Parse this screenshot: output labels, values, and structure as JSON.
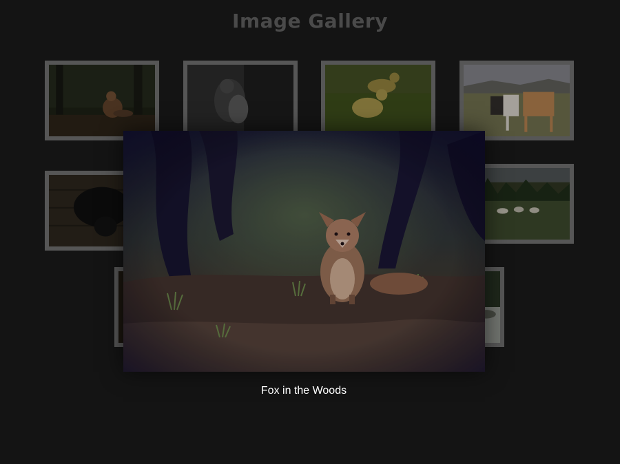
{
  "gallery": {
    "title": "Image Gallery",
    "thumbnails": [
      {
        "subject": "fox"
      },
      {
        "subject": "bw-animal"
      },
      {
        "subject": "ducklings"
      },
      {
        "subject": "horses"
      },
      {
        "subject": "black-dog"
      },
      {
        "subject": "hidden"
      },
      {
        "subject": "hidden"
      },
      {
        "subject": "field-horses"
      },
      {
        "subject": "dark-photo"
      },
      {
        "subject": "hidden"
      },
      {
        "subject": "hidden"
      },
      {
        "subject": "lake-rocks"
      }
    ]
  },
  "lightbox": {
    "image_subject": "fox-in-woods",
    "caption": "Fox in the Woods"
  },
  "colors": {
    "background": "#141414",
    "title": "#4a4a4a",
    "thumb_frame": "#565656",
    "caption": "#ffffff"
  }
}
